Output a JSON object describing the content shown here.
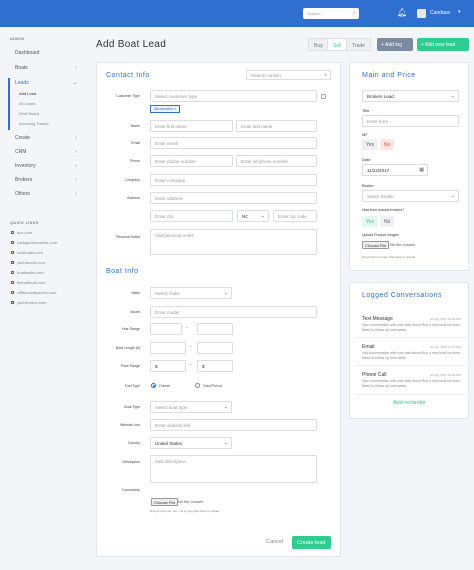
{
  "topbar": {
    "search_placeholder": "Search...",
    "search_icon": "search-icon",
    "user_name": "Candace"
  },
  "sidebar": {
    "admin_heading": "ADMIN",
    "items": [
      {
        "label": "Dashboard"
      },
      {
        "label": "Boats"
      },
      {
        "label": "Leads"
      },
      {
        "label": "Create"
      },
      {
        "label": "CRM"
      },
      {
        "label": "Inventory"
      },
      {
        "label": "Brokers"
      },
      {
        "label": "Others"
      }
    ],
    "leads_sub": [
      "Add Lead",
      "All Leads",
      "Deal Board",
      "Incoming Trades"
    ],
    "quick_links_heading": "QUICK LINKS",
    "quick_links": [
      "buc.com",
      "nadaguidesonline.com",
      "soldboats.com",
      "yachtworld.com",
      "boattrader.com",
      "thehalftruth.com",
      "cliffshorealyachts.com",
      "yachtbroker.com"
    ]
  },
  "page": {
    "title": "Add Boat Lead"
  },
  "toolbar": {
    "buy": "Buy",
    "sell": "Sell",
    "trade": "Trade",
    "add_log": "+ Add log",
    "add_new_lead": "+ Add new lead"
  },
  "contact": {
    "section_title": "Contact Info",
    "search_placeholder": "Search contact",
    "labels": {
      "customer_type": "Customer Type",
      "name": "Name",
      "email": "Email",
      "phone": "Phone",
      "company": "Company",
      "address": "Address",
      "personal_notes": "Personal Notes"
    },
    "customer_type_placeholder": "Select customer type",
    "tag": "Wholesalers ×",
    "first_name": "Enter first name",
    "last_name": "Enter last name",
    "email": "Enter email",
    "phone": "Enter phone number",
    "alt_phone": "Enter alt phone number",
    "company": "Enter company",
    "address": "Enter address",
    "city": "Enter city",
    "state": "NC",
    "zip": "Enter zip code",
    "notes": "Add personal notes"
  },
  "boat": {
    "section_title": "Boat Info",
    "labels": {
      "make": "Make",
      "model": "Model",
      "year_range": "Year Range",
      "boat_length": "Boat Length (ft)",
      "price_range": "Price Range",
      "fuel_type": "Fuel Type",
      "boat_type": "Boat Type",
      "website_link": "Website Link",
      "country": "Country",
      "description": "Description",
      "documents": "Documents"
    },
    "make_placeholder": "Select make",
    "model_placeholder": "Enter model",
    "price_min": "$",
    "price_max": "$",
    "fuel_options": [
      "Diesel",
      "Gas/Petrol"
    ],
    "boat_type_placeholder": "Select boat type",
    "website_placeholder": "Enter website link",
    "country": "United States",
    "description_placeholder": "Add description",
    "choose_file": "Choose File",
    "no_file": "No file chosen",
    "doc_hint": "Drag & drop pdf, doc, xls or jpeg files here to upload"
  },
  "actions": {
    "cancel": "Cancel",
    "create": "Create lead"
  },
  "main_price": {
    "title": "Main and Price",
    "source": "Brokers Lead",
    "title_label": "Title",
    "title_placeholder": "Enter from",
    "mf_label": "MF",
    "yes": "Yes",
    "no": "No",
    "date_label": "Date",
    "date_value": "11/22/2017",
    "broker_label": "Broker",
    "broker_placeholder": "Select Broker",
    "hide_label": "Hide from outside brokers?",
    "upload_label": "Upload Product Images",
    "choose_file": "Choose File",
    "no_file": "No file chosen",
    "upload_hint": "Drag & Drop Image Files here to upload"
  },
  "logged": {
    "title": "Logged Conversations",
    "items": [
      {
        "type": "Text Message",
        "date": "Oct 22, 2017 12:51 PM",
        "body": "Had conversation with new lead about Buy a new boat for them. Need to follow up next week."
      },
      {
        "type": "Email",
        "date": "Oct 22, 2017 12:51 PM",
        "body": "Had conversation with new lead about Buy a new boat for them. Need to follow up next week."
      },
      {
        "type": "Phone Call",
        "date": "Oct 22, 2017 12:51 PM",
        "body": "Had conversation with new lead about Buy a new boat for them. Need to follow up next week."
      }
    ],
    "add_reminder": "Add reminder"
  },
  "colors": {
    "primary": "#2f6fd0",
    "accent": "#2ecc8f",
    "danger": "#e34b4b"
  }
}
